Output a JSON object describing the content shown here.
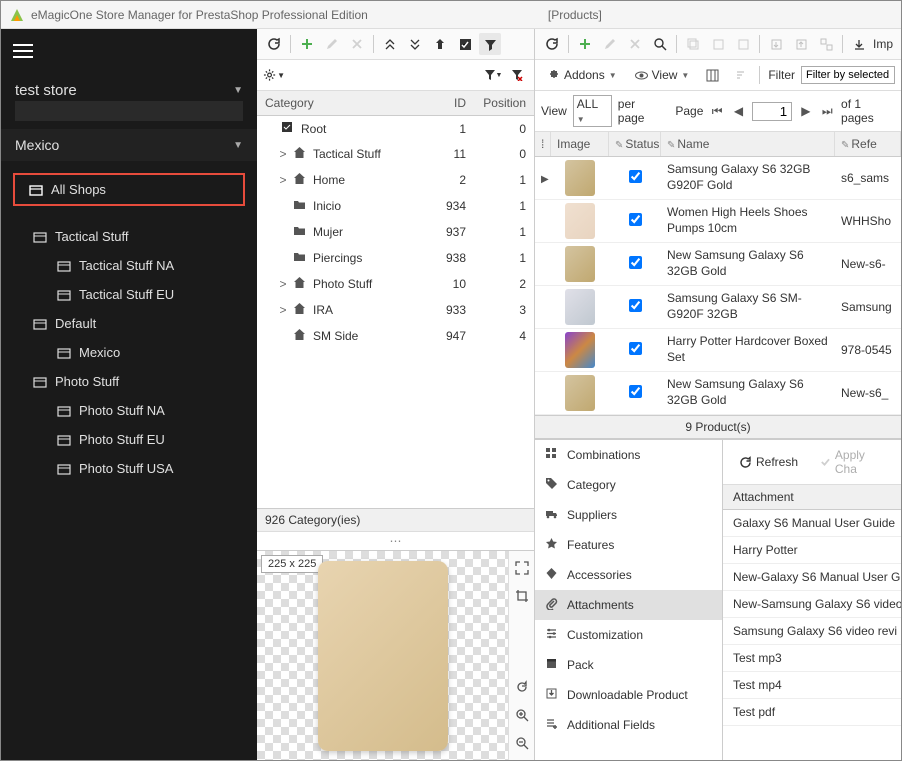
{
  "titlebar": {
    "title": "eMagicOne Store Manager for PrestaShop Professional Edition",
    "context": "[Products]"
  },
  "sidebar": {
    "store_name": "test store",
    "country": "Mexico",
    "all_shops": "All Shops",
    "tree": [
      {
        "label": "Tactical Stuff",
        "indent": 1
      },
      {
        "label": "Tactical Stuff NA",
        "indent": 2
      },
      {
        "label": "Tactical Stuff EU",
        "indent": 2
      },
      {
        "label": "Default",
        "indent": 1
      },
      {
        "label": "Mexico",
        "indent": 2
      },
      {
        "label": "Photo Stuff",
        "indent": 1
      },
      {
        "label": "Photo Stuff NA",
        "indent": 2
      },
      {
        "label": "Photo Stuff EU",
        "indent": 2
      },
      {
        "label": "Photo Stuff USA",
        "indent": 2
      }
    ]
  },
  "categories": {
    "header": {
      "c1": "Category",
      "c2": "ID",
      "c3": "Position"
    },
    "root_label": "Root",
    "root_id": "1",
    "root_pos": "0",
    "rows": [
      {
        "expand": ">",
        "icon": "home",
        "name": "Tactical Stuff",
        "id": "11",
        "pos": "0"
      },
      {
        "expand": ">",
        "icon": "home",
        "name": "Home",
        "id": "2",
        "pos": "1"
      },
      {
        "expand": "",
        "icon": "folder",
        "name": "Inicio",
        "id": "934",
        "pos": "1"
      },
      {
        "expand": "",
        "icon": "folder",
        "name": "Mujer",
        "id": "937",
        "pos": "1"
      },
      {
        "expand": "",
        "icon": "folder",
        "name": "Piercings",
        "id": "938",
        "pos": "1"
      },
      {
        "expand": ">",
        "icon": "home",
        "name": "Photo Stuff",
        "id": "10",
        "pos": "2"
      },
      {
        "expand": ">",
        "icon": "home",
        "name": "IRA",
        "id": "933",
        "pos": "3"
      },
      {
        "expand": "",
        "icon": "home",
        "name": "SM Side",
        "id": "947",
        "pos": "4"
      }
    ],
    "footer": "926 Category(ies)"
  },
  "preview": {
    "badge": "225 x 225"
  },
  "products": {
    "addons_label": "Addons",
    "view_label": "View",
    "filter_label": "Filter",
    "filter_value": "Filter by selected",
    "view_word": "View",
    "all": "ALL",
    "per_page": "per page",
    "page_label": "Page",
    "page_num": "1",
    "of_pages": "of 1 pages",
    "import_label": "Imp",
    "header": {
      "img": "Image",
      "status": "Status",
      "name": "Name",
      "ref": "Refe"
    },
    "rows": [
      {
        "thumb": "gold",
        "name": "Samsung Galaxy S6 32GB G920F Gold",
        "ref": "s6_sams"
      },
      {
        "thumb": "heel",
        "name": "Women High Heels Shoes Pumps 10cm",
        "ref": "WHHSho"
      },
      {
        "thumb": "gold",
        "name": "New Samsung Galaxy S6 32GB Gold",
        "ref": "New-s6-"
      },
      {
        "thumb": "silver",
        "name": "Samsung Galaxy S6 SM-G920F 32GB",
        "ref": "Samsung"
      },
      {
        "thumb": "books",
        "name": "Harry Potter Hardcover Boxed Set",
        "ref": "978-0545"
      },
      {
        "thumb": "gold",
        "name": "New Samsung Galaxy S6 32GB Gold",
        "ref": "New-s6_"
      }
    ],
    "count": "9 Product(s)"
  },
  "tabs": [
    {
      "icon": "grid",
      "label": "Combinations"
    },
    {
      "icon": "tag",
      "label": "Category"
    },
    {
      "icon": "truck",
      "label": "Suppliers"
    },
    {
      "icon": "star",
      "label": "Features"
    },
    {
      "icon": "diamond",
      "label": "Accessories"
    },
    {
      "icon": "clip",
      "label": "Attachments",
      "active": true
    },
    {
      "icon": "sliders",
      "label": "Customization"
    },
    {
      "icon": "box",
      "label": "Pack"
    },
    {
      "icon": "download",
      "label": "Downloadable Product"
    },
    {
      "icon": "plus",
      "label": "Additional Fields"
    }
  ],
  "attachments": {
    "refresh": "Refresh",
    "apply": "Apply Cha",
    "header": "Attachment",
    "rows": [
      "Galaxy S6 Manual User Guide",
      "Harry Potter",
      "New-Galaxy S6 Manual User G",
      "New-Samsung Galaxy S6 video",
      "Samsung Galaxy S6 video revi",
      "Test mp3",
      "Test mp4",
      "Test pdf"
    ]
  }
}
